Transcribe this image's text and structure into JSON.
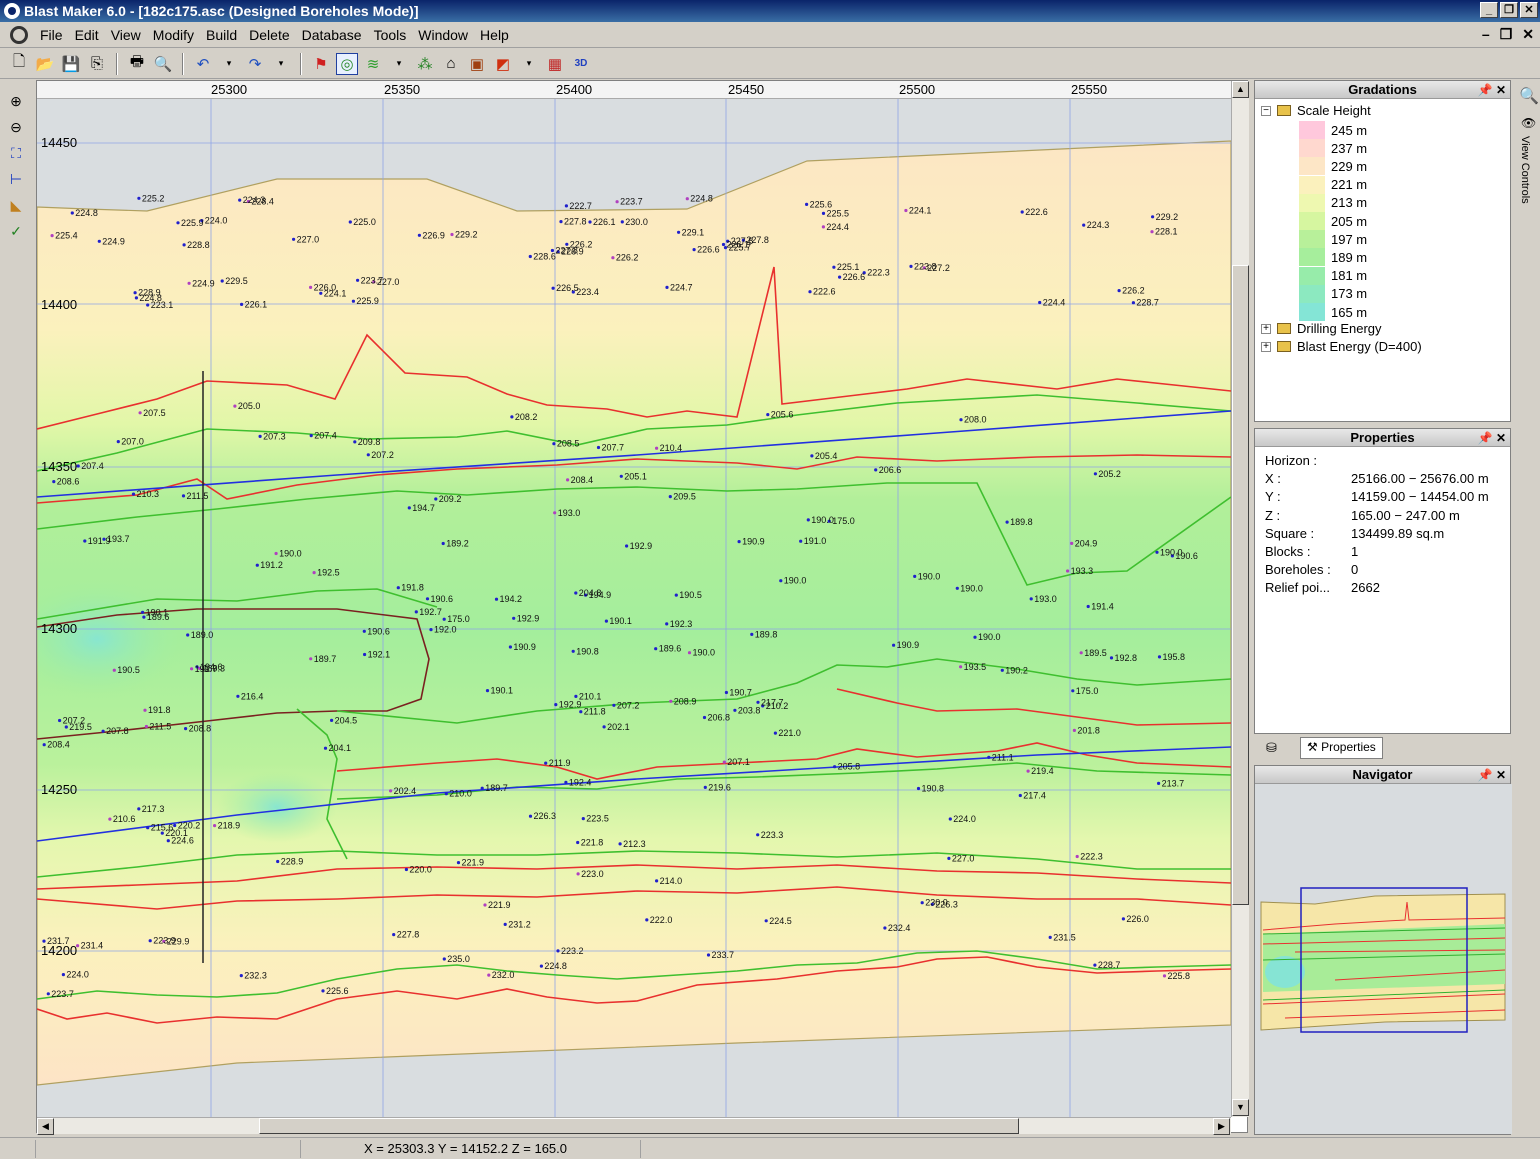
{
  "window": {
    "title": "Blast Maker 6.0 - [182c175.asc (Designed Boreholes Mode)]"
  },
  "menu": [
    "File",
    "Edit",
    "View",
    "Modify",
    "Build",
    "Delete",
    "Database",
    "Tools",
    "Window",
    "Help"
  ],
  "toolbar": {
    "icons": [
      "new-icon",
      "open-icon",
      "save-icon",
      "copy-icon",
      "print-icon",
      "preview-icon",
      "undo-icon",
      "redo-icon",
      "flag-icon",
      "contour-icon",
      "layers-icon",
      "grid-icon",
      "house-icon",
      "block-icon",
      "palette-icon",
      "pattern-icon",
      "3d-icon"
    ],
    "label_3d": "3D"
  },
  "ruler": {
    "x_ticks": [
      "25300",
      "25350",
      "25400",
      "25450",
      "25500",
      "25550"
    ],
    "y_ticks": [
      "14450",
      "14400",
      "14350",
      "14300",
      "14250",
      "14200"
    ]
  },
  "map": {
    "elevations": [
      "226.2",
      "225.9",
      "226.9",
      "228.9",
      "227.8",
      "227.0",
      "225.6",
      "230.0",
      "225.5",
      "226.6",
      "228.4",
      "228.7",
      "228.8",
      "229.2",
      "228.6",
      "224.4",
      "226.1",
      "227.8",
      "229.1",
      "229.5",
      "229.2",
      "224.8",
      "224.1",
      "226.1",
      "227.8",
      "227.2",
      "224.0",
      "222.7",
      "224.9",
      "225.1",
      "228.1",
      "227.8",
      "226.5",
      "226.2",
      "225.0",
      "224.1",
      "223.7",
      "224.4",
      "226.2",
      "223.8",
      "224.8",
      "226.9",
      "227.0",
      "226.6",
      "225.9",
      "225.4",
      "226.1",
      "223.1",
      "223.4",
      "225.7",
      "224.9",
      "224.3",
      "224.8",
      "222.3",
      "222.6",
      "226.0",
      "224.3",
      "225.2",
      "224.7",
      "222.6",
      "223.7",
      "207.2",
      "207.0",
      "207.4",
      "208.0",
      "205.0",
      "205.6",
      "208.2",
      "207.7",
      "208.6",
      "208.4",
      "209.2",
      "206.6",
      "209.8",
      "210.3",
      "207.5",
      "207.3",
      "207.4",
      "208.5",
      "209.5",
      "210.4",
      "211.5",
      "205.4",
      "205.2",
      "204.8",
      "204.9",
      "205.1",
      "190.0",
      "190.5",
      "190.0",
      "193.0",
      "190.6",
      "191.0",
      "190.0",
      "192.9",
      "193.3",
      "193.7",
      "194.9",
      "190.0",
      "175.0",
      "190.0",
      "194.7",
      "190.0",
      "191.9",
      "191.2",
      "192.5",
      "191.8",
      "190.9",
      "189.8",
      "189.2",
      "189.5",
      "190.1",
      "190.1",
      "190.9",
      "190.6",
      "190.5",
      "190.8",
      "191.4",
      "192.9",
      "194.2",
      "191.7",
      "193.0",
      "192.3",
      "175.0",
      "190.9",
      "189.7",
      "175.0",
      "190.1",
      "190.0",
      "189.6",
      "189.3",
      "190.7",
      "190.6",
      "192.7",
      "192.8",
      "193.5",
      "192.1",
      "194.6",
      "195.8",
      "192.0",
      "190.0",
      "189.0",
      "190.2",
      "189.6",
      "189.8",
      "191.8",
      "189.7",
      "190.8",
      "192.4",
      "192.9",
      "201.8",
      "204.5",
      "207.8",
      "210.0",
      "211.1",
      "208.9",
      "211.8",
      "202.1",
      "204.1",
      "206.8",
      "207.1",
      "207.2",
      "208.4",
      "210.1",
      "210.2",
      "211.5",
      "211.9",
      "213.7",
      "216.4",
      "217.4",
      "219.4",
      "219.6",
      "219.5",
      "217.7",
      "221.0",
      "202.4",
      "203.8",
      "205.8",
      "207.2",
      "208.8",
      "210.6",
      "212.3",
      "214.0",
      "215.6",
      "217.3",
      "218.9",
      "220.2",
      "220.1",
      "220.0",
      "221.8",
      "222.3",
      "221.9",
      "223.5",
      "224.0",
      "223.3",
      "223.0",
      "224.6",
      "226.3",
      "227.0",
      "228.9",
      "229.9",
      "230.0",
      "231.2",
      "231.7",
      "232.4",
      "231.4",
      "223.2",
      "224.0",
      "224.8",
      "226.3",
      "225.8",
      "226.0",
      "227.8",
      "228.7",
      "231.5",
      "232.0",
      "232.3",
      "233.7",
      "235.0",
      "223.9",
      "221.9",
      "222.0",
      "223.7",
      "224.5",
      "225.6"
    ]
  },
  "gradations": {
    "title": "Gradations",
    "root": "Scale Height",
    "scale": [
      {
        "label": "245 m",
        "color": "#ffc8dc"
      },
      {
        "label": "237 m",
        "color": "#ffd8cf"
      },
      {
        "label": "229 m",
        "color": "#fde6c6"
      },
      {
        "label": "221 m",
        "color": "#fbf1bd"
      },
      {
        "label": "213 m",
        "color": "#eef8b0"
      },
      {
        "label": "205 m",
        "color": "#d6f6a0"
      },
      {
        "label": "197 m",
        "color": "#b8f09a"
      },
      {
        "label": "189 m",
        "color": "#a6ee9c"
      },
      {
        "label": "181 m",
        "color": "#97ecaa"
      },
      {
        "label": "173 m",
        "color": "#8ce9c0"
      },
      {
        "label": "165 m",
        "color": "#84e5d6"
      }
    ],
    "folders": [
      "Drilling Energy",
      "Blast Energy (D=400)"
    ]
  },
  "properties": {
    "title": "Properties",
    "rows": [
      {
        "key": "Horizon :",
        "value": ""
      },
      {
        "key": "X :",
        "value": "25166.00 − 25676.00 m"
      },
      {
        "key": "Y :",
        "value": "14159.00 − 14454.00 m"
      },
      {
        "key": "Z :",
        "value": "165.00 − 247.00 m"
      },
      {
        "key": "Square :",
        "value": "134499.89 sq.m"
      },
      {
        "key": "Blocks :",
        "value": "1"
      },
      {
        "key": "Boreholes :",
        "value": "0"
      },
      {
        "key": "Relief poi...",
        "value": "2662"
      }
    ],
    "tab_label": "Properties"
  },
  "navigator": {
    "title": "Navigator"
  },
  "view_controls": {
    "label": "View Controls"
  },
  "status": {
    "coords": "X = 25303.3   Y = 14152.2   Z = 165.0"
  },
  "colors": {
    "contour_red": "#e8302e",
    "contour_green": "#3fbf2f",
    "contour_blue": "#2230e0",
    "contour_brown": "#7a2020",
    "point_blue": "#2020cc",
    "point_magenta": "#b040c0"
  }
}
